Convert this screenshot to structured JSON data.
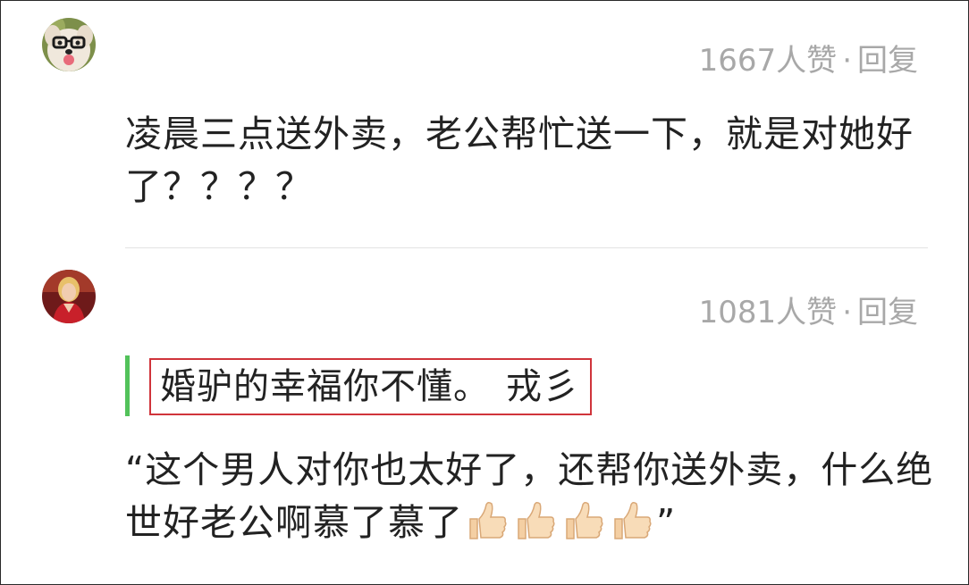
{
  "comments": [
    {
      "avatar_icon": "dog-with-glasses-avatar",
      "likes_text": "1667人赞",
      "separator": "·",
      "reply_label": "回复",
      "text": "凌晨三点送外卖，老公帮忙送一下，就是对她好了？？？？"
    },
    {
      "avatar_icon": "woman-red-dress-avatar",
      "likes_text": "1081人赞",
      "separator": "·",
      "reply_label": "回复",
      "quote": {
        "text": "婚驴的幸福你不懂。",
        "author": "戎彡",
        "bar_color": "#52c25a",
        "highlight_border_color": "#d0343b"
      },
      "text": "“这个男人对你也太好了，还帮你送外卖，什么绝世好老公啊慕了慕了",
      "text_end": "”",
      "emoji_icons": [
        "thumbs-up-icon",
        "thumbs-up-icon",
        "thumbs-up-icon",
        "thumbs-up-icon"
      ]
    }
  ]
}
